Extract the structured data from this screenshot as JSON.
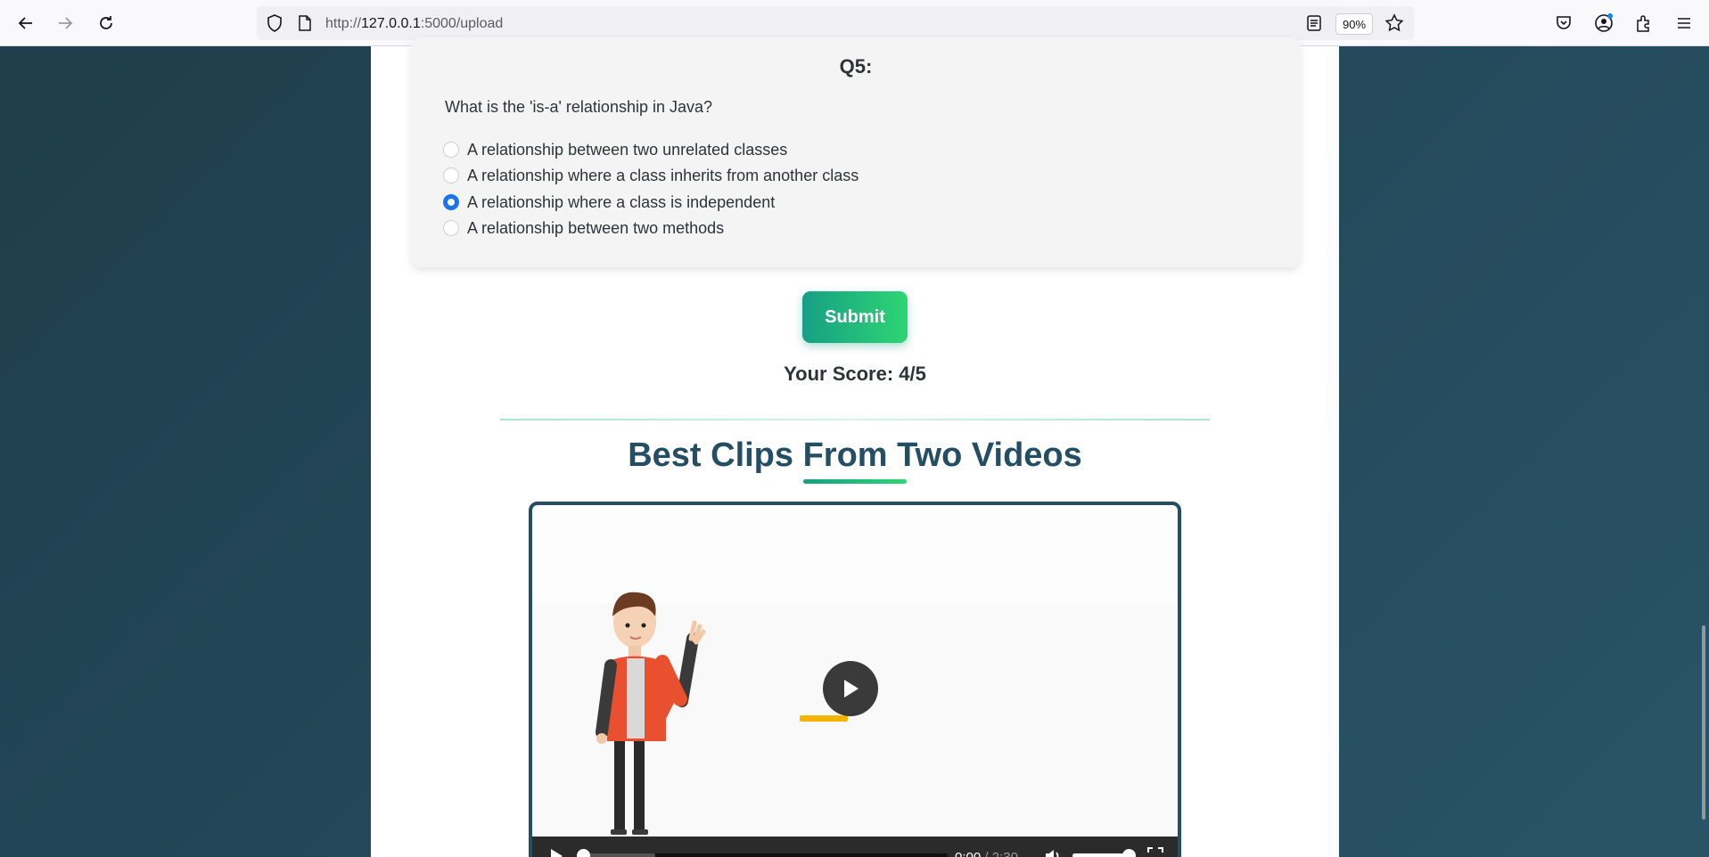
{
  "browser": {
    "url_prefix": "http://",
    "url_host": "127.0.0.1",
    "url_rest": ":5000/upload",
    "zoom": "90%"
  },
  "quiz": {
    "question_number": "Q5:",
    "question_text": "What is the 'is-a' relationship in Java?",
    "options": [
      {
        "label": "A relationship between two unrelated classes",
        "checked": false
      },
      {
        "label": "A relationship where a class inherits from another class",
        "checked": false
      },
      {
        "label": "A relationship where a class is independent",
        "checked": true
      },
      {
        "label": "A relationship between two methods",
        "checked": false
      }
    ],
    "submit_label": "Submit",
    "score_text": "Your Score: 4/5"
  },
  "clips": {
    "title": "Best Clips From Two Videos",
    "video": {
      "current_time": "0:00",
      "separator": " / ",
      "duration": "2:30",
      "progress": 0.0,
      "buffered": 0.2,
      "volume": 1.0
    }
  },
  "colors": {
    "accent_start": "#16a085",
    "accent_end": "#2ed573",
    "title": "#234e63",
    "radio_checked": "#1a73e8"
  }
}
